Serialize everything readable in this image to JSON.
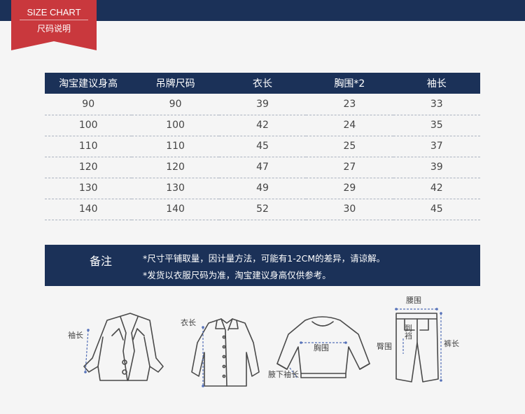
{
  "header": {
    "badge_title": "SIZE CHART",
    "badge_subtitle": "尺码说明"
  },
  "table": {
    "columns": [
      "淘宝建议身高",
      "吊牌尺码",
      "衣长",
      "胸围*2",
      "袖长"
    ],
    "rows": [
      [
        "90",
        "90",
        "39",
        "23",
        "33"
      ],
      [
        "100",
        "100",
        "42",
        "24",
        "35"
      ],
      [
        "110",
        "110",
        "45",
        "25",
        "37"
      ],
      [
        "120",
        "120",
        "47",
        "27",
        "39"
      ],
      [
        "130",
        "130",
        "49",
        "29",
        "42"
      ],
      [
        "140",
        "140",
        "52",
        "30",
        "45"
      ]
    ]
  },
  "notes": {
    "title": "备注",
    "line1": "*尺寸平铺取量，因计量方法，可能有1-2CM的差异，请谅解。",
    "line2": "*发货以衣服尺码为准，淘宝建议身高仅供参考。"
  },
  "diagrams": {
    "coat_sleeve": "袖长",
    "shirt_length": "衣长",
    "sweater_chest": "胸围",
    "sweater_sleeve": "腋下袖长",
    "pants_waist": "腰围",
    "pants_rise": "到\n裆",
    "pants_hip": "臀围",
    "pants_length": "裤长"
  },
  "colors": {
    "navy": "#1b3158",
    "red_badge": "#c9383d",
    "measure_line": "#5470b8"
  }
}
